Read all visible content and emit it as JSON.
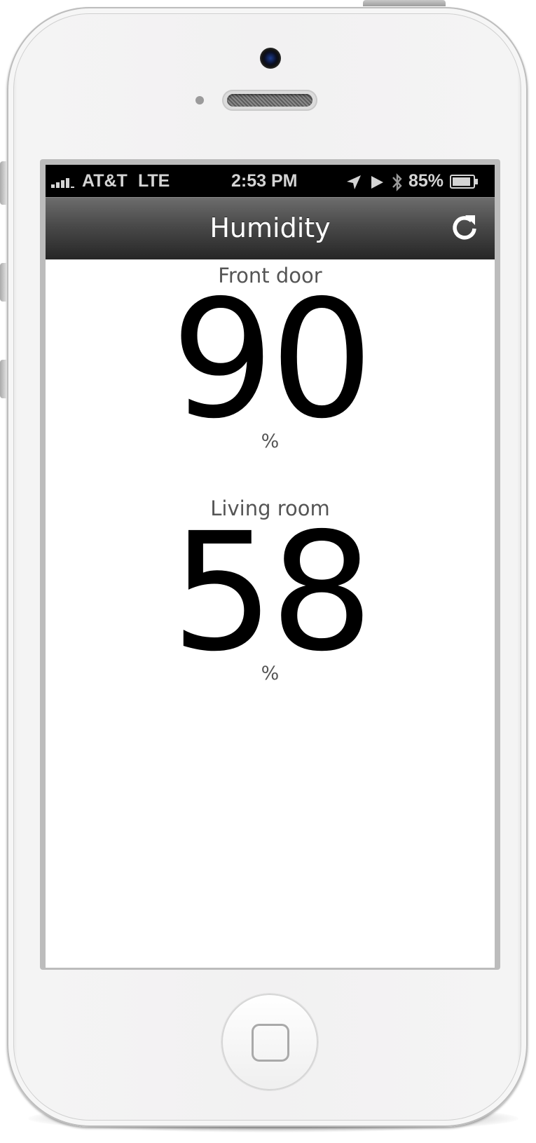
{
  "status_bar": {
    "carrier": "AT&T",
    "network": "LTE",
    "time": "2:53 PM",
    "battery_percent": "85%",
    "signal_bars": 4
  },
  "nav_bar": {
    "title": "Humidity",
    "refresh_icon": "refresh-icon"
  },
  "sensors": [
    {
      "name": "Front door",
      "value": "90",
      "unit": "%"
    },
    {
      "name": "Living room",
      "value": "58",
      "unit": "%"
    }
  ],
  "colors": {
    "status_bar_bg": "#000000",
    "nav_bar_top": "#6d6d6d",
    "nav_bar_bottom": "#262626",
    "value_text": "#000000",
    "label_text": "#555555"
  }
}
